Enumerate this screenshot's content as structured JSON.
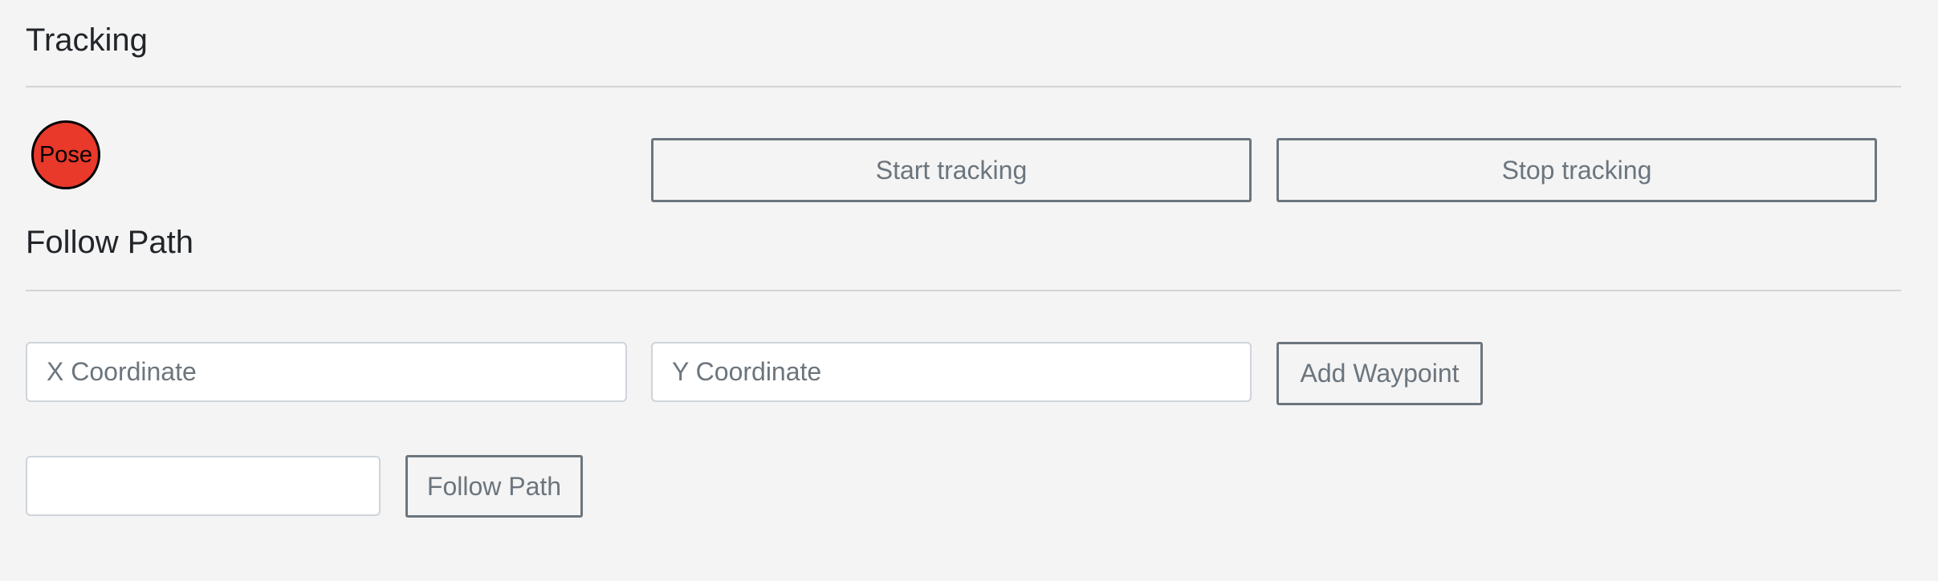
{
  "tracking": {
    "title": "Tracking",
    "pose_label": "Pose",
    "pose_color": "#e8392b",
    "start_label": "Start tracking",
    "stop_label": "Stop tracking"
  },
  "follow_path": {
    "title": "Follow Path",
    "x_placeholder": "X Coordinate",
    "y_placeholder": "Y Coordinate",
    "add_waypoint_label": "Add Waypoint",
    "path_input_value": "",
    "follow_label": "Follow Path"
  }
}
